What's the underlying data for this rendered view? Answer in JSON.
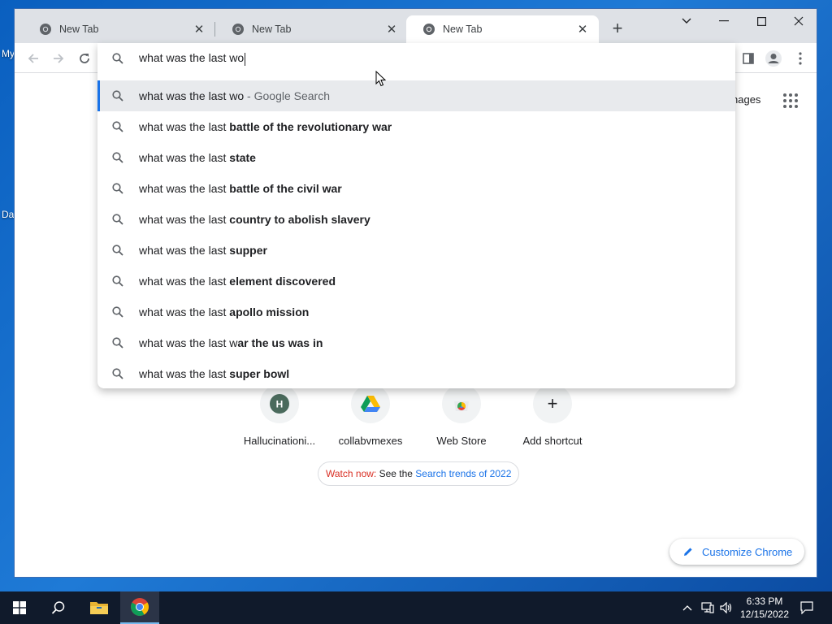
{
  "desktop": {
    "icon_label_1": "My",
    "icon_label_2": "Da"
  },
  "tabs": [
    {
      "title": "New Tab",
      "active": false
    },
    {
      "title": "New Tab",
      "active": false
    },
    {
      "title": "New Tab",
      "active": true
    }
  ],
  "omnibox": {
    "typed": "what was the last wo",
    "suggestions": [
      {
        "prefix": "what was the last wo",
        "bold": "",
        "suffix": " - Google Search",
        "selected": true
      },
      {
        "prefix": "what was the last ",
        "bold": "battle of the revolutionary war",
        "suffix": ""
      },
      {
        "prefix": "what was the last ",
        "bold": "state",
        "suffix": ""
      },
      {
        "prefix": "what was the last ",
        "bold": "battle of the civil war",
        "suffix": ""
      },
      {
        "prefix": "what was the last ",
        "bold": "country to abolish slavery",
        "suffix": ""
      },
      {
        "prefix": "what was the last ",
        "bold": "supper",
        "suffix": ""
      },
      {
        "prefix": "what was the last ",
        "bold": "element discovered",
        "suffix": ""
      },
      {
        "prefix": "what was the last ",
        "bold": "apollo mission",
        "suffix": ""
      },
      {
        "prefix": "what was the last w",
        "bold": "ar the us was in",
        "suffix": ""
      },
      {
        "prefix": "what was the last ",
        "bold": "super bowl",
        "suffix": ""
      }
    ]
  },
  "ntp": {
    "images_link": "nages",
    "shortcuts": [
      {
        "label": "Hallucinationi...",
        "initial": "H"
      },
      {
        "label": "collabvmexes"
      },
      {
        "label": "Web Store"
      },
      {
        "label": "Add shortcut",
        "symbol": "+"
      }
    ],
    "trends": {
      "red": "Watch now:",
      "middle": " See the ",
      "link": "Search trends of 2022"
    },
    "customize_label": "Customize Chrome"
  },
  "taskbar": {
    "time": "6:33 PM",
    "date": "12/15/2022"
  },
  "colors": {
    "accent": "#1a73e8",
    "taskbar": "#101a2b",
    "tabstrip": "#dee1e6"
  }
}
